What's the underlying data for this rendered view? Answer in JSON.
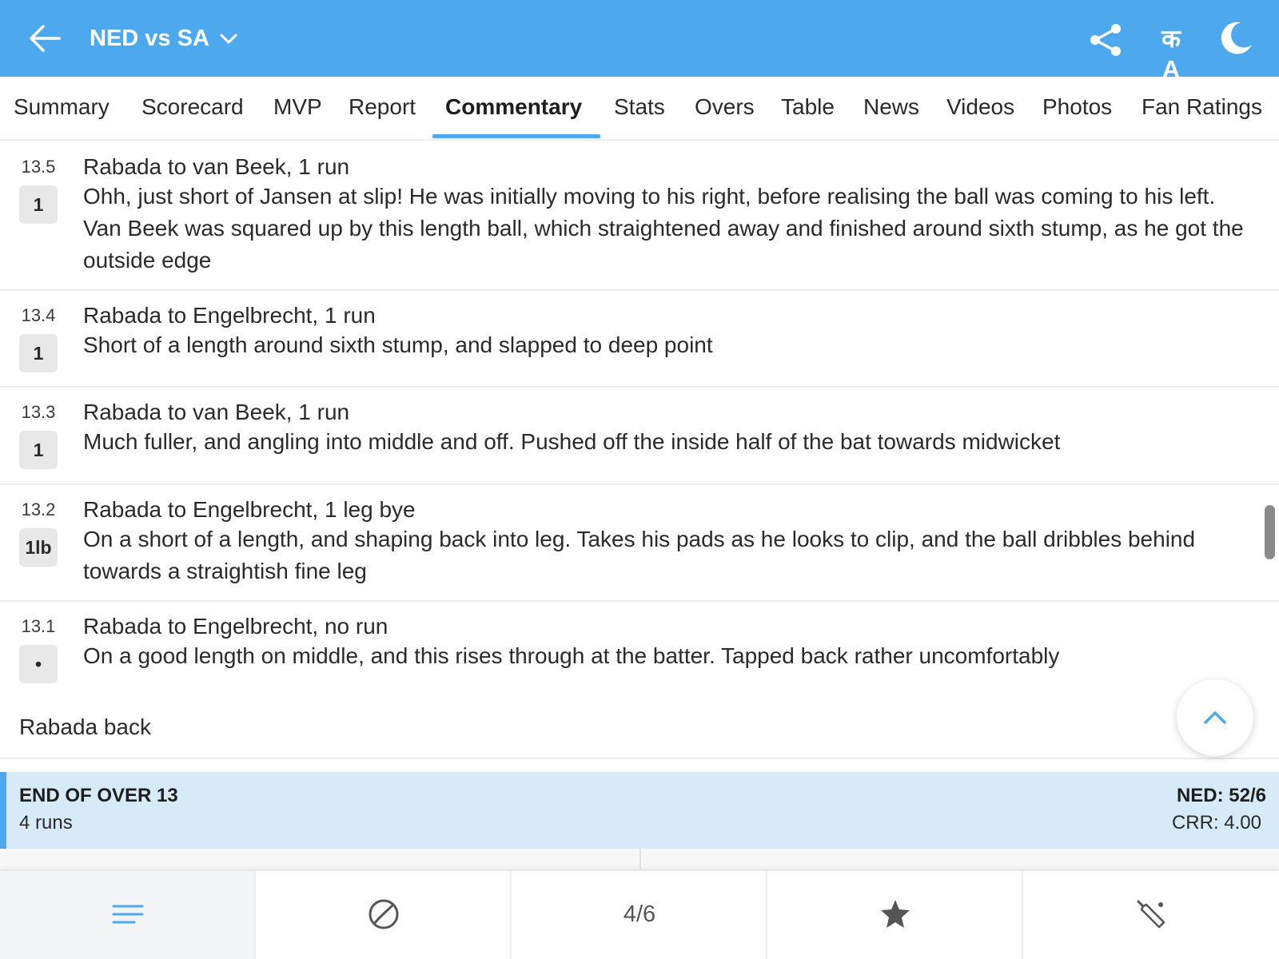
{
  "header": {
    "back_icon": "arrow-left-icon",
    "title": "NED vs SA",
    "title_icon": "chevron-down-icon",
    "share_icon": "share-icon",
    "lang_label": "क A",
    "theme_icon": "moon-icon",
    "background_color": "#4ea8ee"
  },
  "tabs": {
    "active": "Commentary",
    "items": [
      {
        "label": "Summary"
      },
      {
        "label": "Scorecard"
      },
      {
        "label": "MVP"
      },
      {
        "label": "Report"
      },
      {
        "label": "Commentary"
      },
      {
        "label": "Stats"
      },
      {
        "label": "Overs"
      },
      {
        "label": "Table"
      },
      {
        "label": "News"
      },
      {
        "label": "Videos"
      },
      {
        "label": "Photos"
      },
      {
        "label": "Fan Ratings"
      }
    ]
  },
  "commentary": [
    {
      "over": "13.5",
      "result": "1",
      "headline": "Rabada to van Beek, 1 run",
      "text": "Ohh, just short of Jansen at slip! He was initially moving to his right, before realising the ball was coming to his left. Van Beek was squared up by this length ball, which straightened away and finished around sixth stump, as he got the outside edge"
    },
    {
      "over": "13.4",
      "result": "1",
      "headline": "Rabada to Engelbrecht, 1 run",
      "text": "Short of a length around sixth stump, and slapped to deep point"
    },
    {
      "over": "13.3",
      "result": "1",
      "headline": "Rabada to van Beek, 1 run",
      "text": "Much fuller, and angling into middle and off. Pushed off the inside half of the bat towards midwicket"
    },
    {
      "over": "13.2",
      "result": "1lb",
      "headline": "Rabada to Engelbrecht, 1 leg bye",
      "text": "On a short of a length, and shaping back into leg. Takes his pads as he looks to clip, and the ball dribbles behind towards a straightish fine leg"
    },
    {
      "over": "13.1",
      "result": "•",
      "headline": "Rabada to Engelbrecht, no run",
      "text": "On a good length on middle, and this rises through at the batter. Tapped back rather uncomfortably"
    }
  ],
  "note": "Rabada back",
  "scroll_top_icon": "chevron-up-icon",
  "end_of_over": {
    "title": "END OF OVER 13",
    "runs": "4 runs",
    "score": "NED: 52/6",
    "crr": "CRR: 4.00",
    "accent_color": "#4ea8ee"
  },
  "bottom_nav": {
    "items": [
      {
        "icon": "menu-lines-icon",
        "active": true
      },
      {
        "icon": "ball-icon"
      },
      {
        "label": "4/6"
      },
      {
        "icon": "star-icon"
      },
      {
        "icon": "cricket-bat-icon"
      }
    ]
  }
}
